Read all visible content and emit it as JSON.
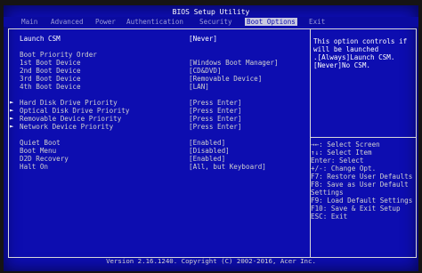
{
  "header": {
    "title": "BIOS Setup Utility"
  },
  "menu": {
    "tabs": [
      "Main",
      "Advanced",
      "Power",
      "Authentication",
      "Security",
      "Boot Options",
      "Exit"
    ],
    "active": "Boot Options"
  },
  "settings": {
    "launch_csm": {
      "label": "Launch CSM",
      "value": "[Never]"
    },
    "boot_priority_heading": "Boot Priority Order",
    "boot_devices": [
      {
        "label": "1st Boot Device",
        "value": "[Windows Boot Manager]"
      },
      {
        "label": "2nd Boot Device",
        "value": "[CD&DVD]"
      },
      {
        "label": "3rd Boot Device",
        "value": "[Removable Device]"
      },
      {
        "label": "4th Boot Device",
        "value": "[LAN]"
      }
    ],
    "priority_submenus": [
      {
        "label": "Hard Disk Drive Priority",
        "value": "[Press Enter]"
      },
      {
        "label": "Optical Disk Drive Priority",
        "value": "[Press Enter]"
      },
      {
        "label": "Removable Device Priority",
        "value": "[Press Enter]"
      },
      {
        "label": "Network Device Priority",
        "value": "[Press Enter]"
      }
    ],
    "misc": [
      {
        "label": "Quiet Boot",
        "value": "[Enabled]"
      },
      {
        "label": "Boot Menu",
        "value": "[Disabled]"
      },
      {
        "label": "D2D Recovery",
        "value": "[Enabled]"
      },
      {
        "label": "Halt On",
        "value": "[All, but Keyboard]"
      }
    ]
  },
  "help": {
    "description": [
      "This option controls if",
      "will be launched",
      ".[Always]Launch CSM.",
      "[Never]No CSM."
    ],
    "keys": [
      "→←: Select Screen",
      "↑↓: Select Item",
      "Enter: Select",
      "+/-: Change Opt.",
      "F7: Restore User Defaults",
      "F8: Save as User Default",
      "Settings",
      "F9: Load Default Settings",
      "F10: Save & Exit Setup",
      "ESC: Exit"
    ]
  },
  "footer": {
    "text": "Version 2.16.1240. Copyright (C) 2002-2016, Acer Inc."
  }
}
